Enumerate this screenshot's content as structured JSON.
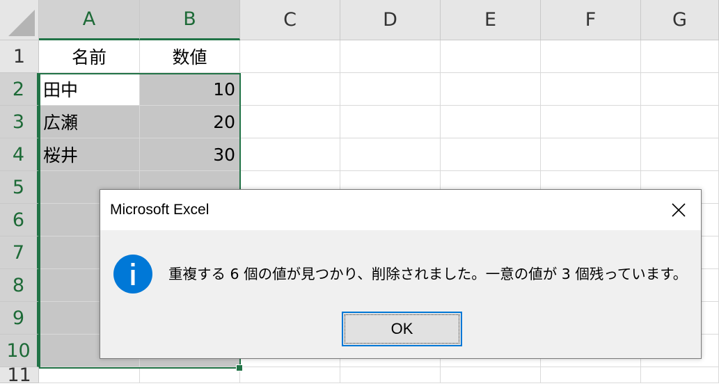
{
  "sheet": {
    "columns": [
      "A",
      "B",
      "C",
      "D",
      "E",
      "F",
      "G"
    ],
    "rows": [
      "1",
      "2",
      "3",
      "4",
      "5",
      "6",
      "7",
      "8",
      "9",
      "10",
      "11"
    ],
    "cells": {
      "A1": "名前",
      "B1": "数値",
      "A2": "田中",
      "B2": "10",
      "A3": "広瀬",
      "B3": "20",
      "A4": "桜井",
      "B4": "30"
    }
  },
  "dialog": {
    "title": "Microsoft Excel",
    "message": "重複する 6 個の値が見つかり、削除されました。一意の値が 3 個残っています。",
    "ok_label": "OK",
    "icon": "info-icon",
    "icon_glyph": "i",
    "close_glyph": "✕"
  },
  "colors": {
    "accent": "#217346",
    "info_icon": "#0078d7",
    "selection_fill": "#c6c6c6"
  }
}
